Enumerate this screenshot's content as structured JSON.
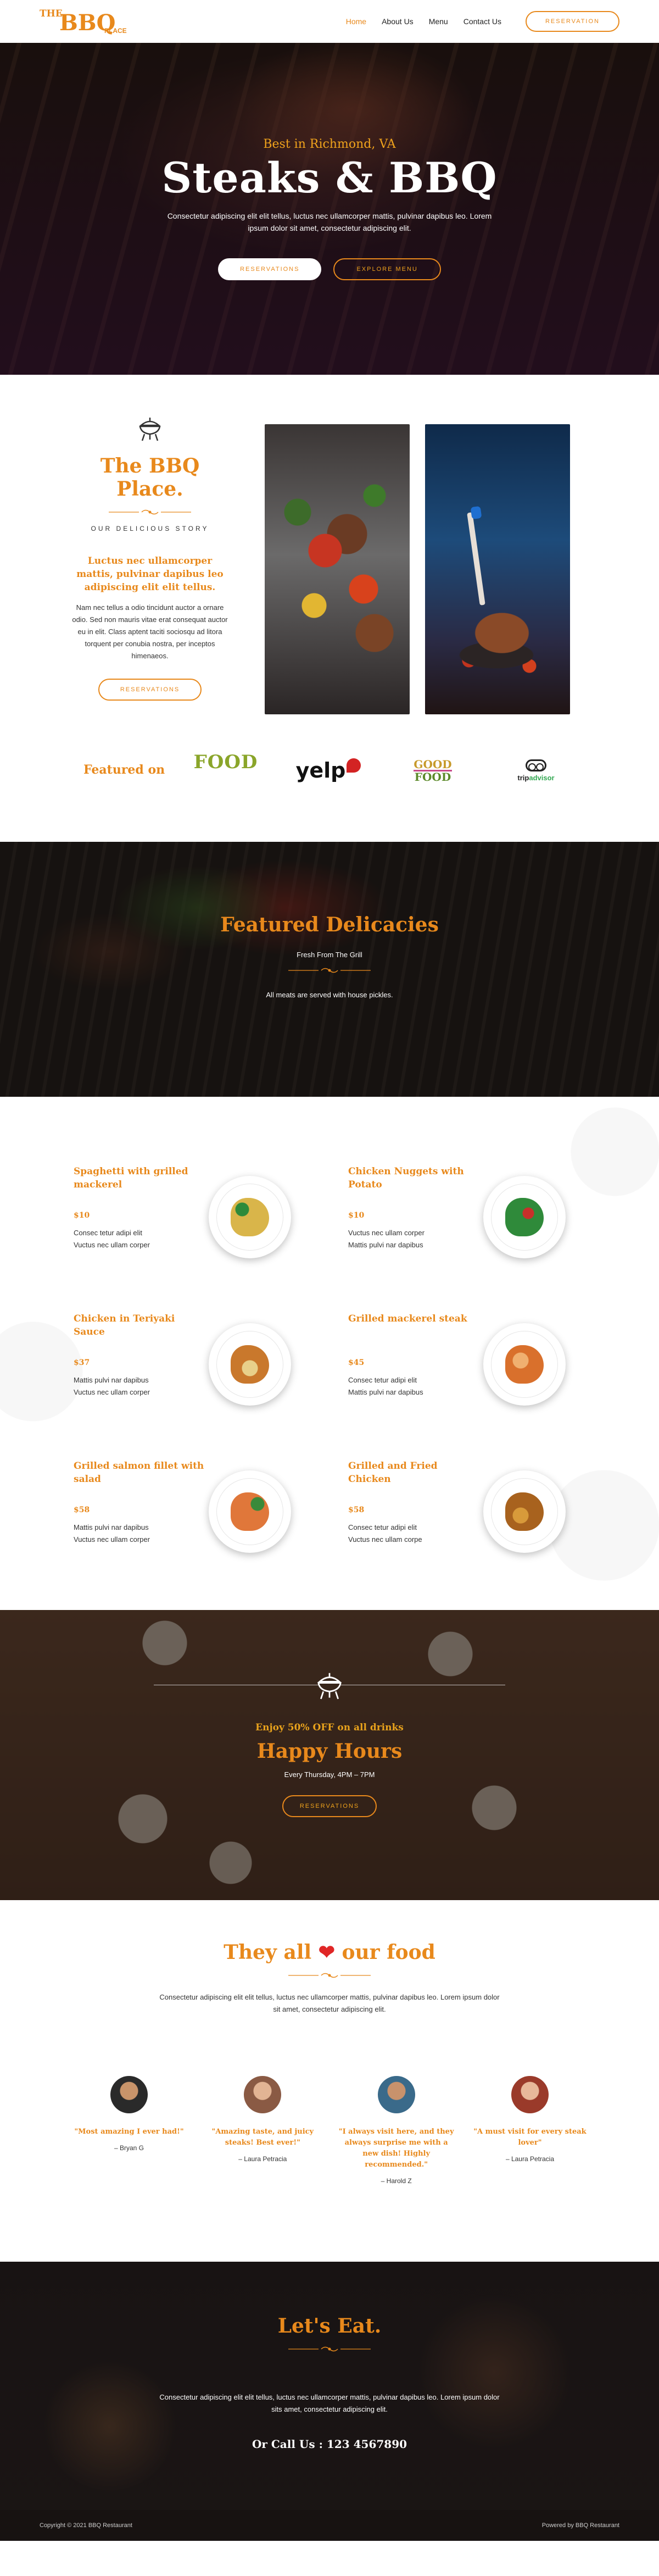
{
  "logo": {
    "the": "THE",
    "bbq": "BBQ",
    "place": "PLACE"
  },
  "nav": {
    "items": [
      "Home",
      "About Us",
      "Menu",
      "Contact Us"
    ],
    "cta": "RESERVATION"
  },
  "hero": {
    "tagline": "Best in Richmond, VA",
    "title": "Steaks & BBQ",
    "text": "Consectetur adipiscing elit elit tellus, luctus nec ullamcorper mattis, pulvinar dapibus leo. Lorem ipsum dolor sit amet, consectetur adipiscing elit.",
    "btn_reservations": "RESERVATIONS",
    "btn_menu": "EXPLORE MENU"
  },
  "story": {
    "title": "The BBQ Place.",
    "kicker": "OUR DELICIOUS STORY",
    "lead": "Luctus nec ullamcorper mattis, pulvinar dapibus leo adipiscing elit elit tellus.",
    "body": "Nam nec tellus a odio tincidunt auctor a ornare odio. Sed non mauris vitae erat consequat auctor eu in elit. Class aptent taciti sociosqu ad litora torquent per conubia nostra, per inceptos himenaeos.",
    "button": "RESERVATIONS"
  },
  "featured_on": {
    "title": "Featured on",
    "brands": {
      "food": "FOOD",
      "yelp": "yelp",
      "good1": "GOOD",
      "good2": "FOOD",
      "trip1": "trip",
      "trip2": "advisor"
    }
  },
  "delicacies": {
    "title": "Featured Delicacies",
    "sub": "Fresh From The Grill",
    "note": "All meats are served with house pickles."
  },
  "menu": {
    "dishes": [
      {
        "name": "Spaghetti with grilled mackerel",
        "price": "$10",
        "d1": "Consec tetur adipi elit",
        "d2": "Vuctus nec ullam corper",
        "color": "#d9b54a"
      },
      {
        "name": "Chicken Nuggets with Potato",
        "price": "$10",
        "d1": "Vuctus nec ullam corper",
        "d2": "Mattis pulvi nar dapibus",
        "color": "#2f8a3a"
      },
      {
        "name": "Chicken in Teriyaki Sauce",
        "price": "$37",
        "d1": "Mattis pulvi nar dapibus",
        "d2": "Vuctus nec ullam corper",
        "color": "#c9782c"
      },
      {
        "name": "Grilled mackerel steak",
        "price": "$45",
        "d1": "Consec tetur adipi elit",
        "d2": "Mattis pulvi nar dapibus",
        "color": "#d9702c"
      },
      {
        "name": "Grilled salmon fillet with salad",
        "price": "$58",
        "d1": "Mattis pulvi nar dapibus",
        "d2": "Vuctus nec ullam corper",
        "color": "#e0773a"
      },
      {
        "name": "Grilled and Fried Chicken",
        "price": "$58",
        "d1": "Consec tetur adipi elit",
        "d2": "Vuctus nec ullam corpe",
        "color": "#a8621e"
      }
    ]
  },
  "happy": {
    "lead": "Enjoy 50% OFF on all drinks",
    "title": "Happy Hours",
    "time": "Every Thursday, 4PM – 7PM",
    "button": "RESERVATIONS"
  },
  "love": {
    "title_pre": "They all",
    "title_post": "our food",
    "intro": "Consectetur adipiscing elit elit tellus, luctus nec ullamcorper mattis, pulvinar dapibus leo. Lorem ipsum dolor sit amet, consectetur adipiscing elit.",
    "testimonials": [
      {
        "quote": "\"Most amazing I ever had!\"",
        "who": "– Bryan G"
      },
      {
        "quote": "\"Amazing taste, and juicy steaks! Best ever!\"",
        "who": "– Laura Petracia"
      },
      {
        "quote": "\"I always visit here, and they always surprise me with a new dish! Highly recommended.\"",
        "who": "– Harold Z"
      },
      {
        "quote": "\"A must visit for every steak lover\"",
        "who": "– Laura Petracia"
      }
    ]
  },
  "eat": {
    "title": "Let's Eat.",
    "text": "Consectetur adipiscing elit elit tellus, luctus nec ullamcorper mattis, pulvinar dapibus leo. Lorem ipsum dolor sits amet, consectetur adipiscing elit.",
    "call": "Or Call Us : 123 4567890"
  },
  "footer": {
    "copyright": "Copyright © 2021 BBQ Restaurant",
    "powered": "Powered by BBQ Restaurant"
  },
  "colors": {
    "accent": "#e8891c",
    "dark": "#171211",
    "heart": "#e02626"
  }
}
